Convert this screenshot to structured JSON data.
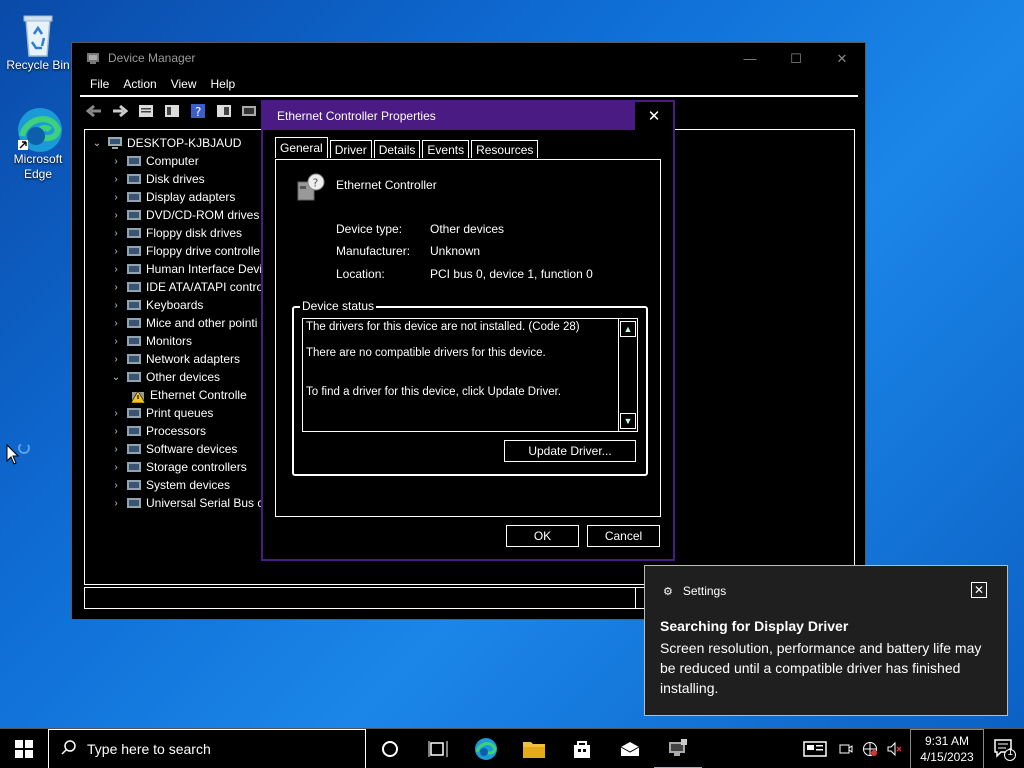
{
  "desktop": {
    "icons": [
      {
        "label": "Recycle Bin",
        "icon": "recycle-bin-icon"
      },
      {
        "label": "Microsoft Edge",
        "icon": "edge-icon"
      }
    ]
  },
  "device_manager": {
    "title": "Device Manager",
    "window_controls": [
      "minimize",
      "maximize",
      "close"
    ],
    "menu": [
      "File",
      "Action",
      "View",
      "Help"
    ],
    "root": "DESKTOP-KJBJAUD",
    "tree": [
      {
        "label": "Computer",
        "icon": "computer-icon",
        "expanded": false
      },
      {
        "label": "Disk drives",
        "icon": "disk-icon",
        "expanded": false
      },
      {
        "label": "Display adapters",
        "icon": "display-icon",
        "expanded": false
      },
      {
        "label": "DVD/CD-ROM drives",
        "icon": "dvd-icon",
        "expanded": false
      },
      {
        "label": "Floppy disk drives",
        "icon": "floppy-icon",
        "expanded": false
      },
      {
        "label": "Floppy drive controlle",
        "icon": "floppy-controller-icon",
        "expanded": false
      },
      {
        "label": "Human Interface Devi",
        "icon": "hid-icon",
        "expanded": false
      },
      {
        "label": "IDE ATA/ATAPI contro",
        "icon": "ide-icon",
        "expanded": false
      },
      {
        "label": "Keyboards",
        "icon": "keyboard-icon",
        "expanded": false
      },
      {
        "label": "Mice and other pointi",
        "icon": "mouse-icon",
        "expanded": false
      },
      {
        "label": "Monitors",
        "icon": "monitor-icon",
        "expanded": false
      },
      {
        "label": "Network adapters",
        "icon": "network-icon",
        "expanded": false
      },
      {
        "label": "Other devices",
        "icon": "other-devices-icon",
        "expanded": true
      },
      {
        "label": "Ethernet Controlle",
        "icon": "warning-device-icon",
        "child": true
      },
      {
        "label": "Print queues",
        "icon": "printer-icon",
        "expanded": false
      },
      {
        "label": "Processors",
        "icon": "processor-icon",
        "expanded": false
      },
      {
        "label": "Software devices",
        "icon": "software-icon",
        "expanded": false
      },
      {
        "label": "Storage controllers",
        "icon": "storage-icon",
        "expanded": false
      },
      {
        "label": "System devices",
        "icon": "system-icon",
        "expanded": false
      },
      {
        "label": "Universal Serial Bus co",
        "icon": "usb-icon",
        "expanded": false
      }
    ]
  },
  "properties": {
    "title": "Ethernet Controller Properties",
    "close": "✕",
    "tabs": [
      "General",
      "Driver",
      "Details",
      "Events",
      "Resources"
    ],
    "active_tab": "General",
    "device_name": "Ethernet Controller",
    "fields": [
      {
        "label": "Device type:",
        "value": "Other devices"
      },
      {
        "label": "Manufacturer:",
        "value": "Unknown"
      },
      {
        "label": "Location:",
        "value": "PCI bus 0, device 1, function 0"
      }
    ],
    "status_legend": "Device status",
    "status_lines": [
      "The drivers for this device are not installed. (Code 28)",
      "There are no compatible drivers for this device.",
      "To find a driver for this device, click Update Driver."
    ],
    "update_driver": "Update Driver...",
    "ok": "OK",
    "cancel": "Cancel"
  },
  "toast": {
    "app": "Settings",
    "title": "Searching for Display Driver",
    "body": "Screen resolution, performance and battery life may be reduced until a compatible driver has finished installing."
  },
  "taskbar": {
    "search_placeholder": "Type here to search",
    "time": "9:31 AM",
    "date": "4/15/2023",
    "notification_count": "1"
  },
  "colors": {
    "dialog_accent": "#4b1b84",
    "desktop": "#0f6ed6"
  }
}
